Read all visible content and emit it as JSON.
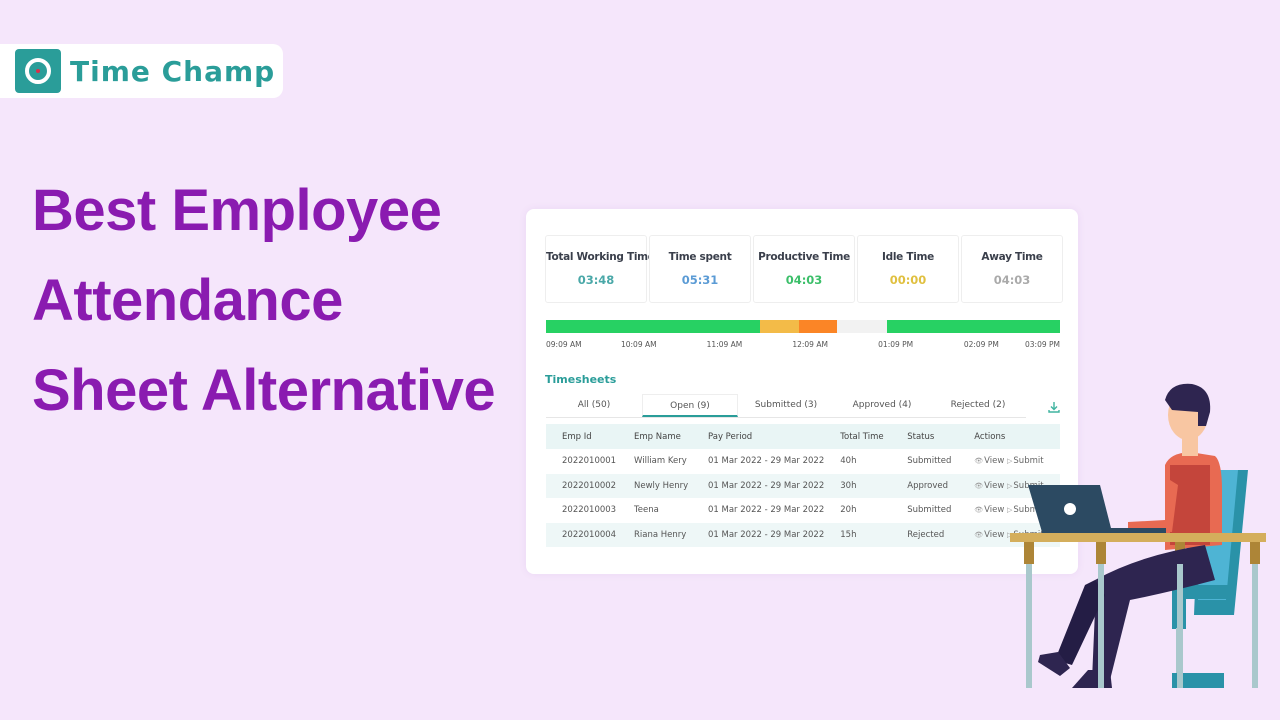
{
  "brand": {
    "name": "Time Champ",
    "icon": "clock-icon",
    "color": "#2a9d99"
  },
  "headline": {
    "lines": [
      "Best Employee",
      "Attendance",
      "Sheet Alternative"
    ],
    "color": "#8a1bb0"
  },
  "stats": [
    {
      "label": "Total Working Time",
      "value": "03:48",
      "color": "#4aa8a8"
    },
    {
      "label": "Time spent",
      "value": "05:31",
      "color": "#5b9bd5"
    },
    {
      "label": "Productive Time",
      "value": "04:03",
      "color": "#3cbf6a"
    },
    {
      "label": "Idle Time",
      "value": "00:00",
      "color": "#e0c040"
    },
    {
      "label": "Away Time",
      "value": "04:03",
      "color": "#aaaaaa"
    }
  ],
  "timeline": {
    "segments": [
      {
        "type": "productive",
        "fraction": 0.417,
        "color": "#27d163"
      },
      {
        "type": "idle",
        "fraction": 0.076,
        "color": "#f3bb48"
      },
      {
        "type": "away",
        "fraction": 0.074,
        "color": "#fb8526"
      },
      {
        "type": "offline",
        "fraction": 0.096,
        "color": "#f2f2f2"
      },
      {
        "type": "productive",
        "fraction": 0.337,
        "color": "#27d163"
      }
    ],
    "ticks": [
      "09:09 AM",
      "10:09 AM",
      "11:09 AM",
      "12:09 AM",
      "01:09 PM",
      "02:09 PM",
      "03:09 PM"
    ]
  },
  "timesheets": {
    "title": "Timesheets",
    "tabs": [
      {
        "label": "All (50)",
        "active": false
      },
      {
        "label": "Open (9)",
        "active": true
      },
      {
        "label": "Submitted (3)",
        "active": false
      },
      {
        "label": "Approved (4)",
        "active": false
      },
      {
        "label": "Rejected (2)",
        "active": false
      }
    ],
    "download_icon": "download-icon",
    "columns": [
      "Emp Id",
      "Emp Name",
      "Pay Period",
      "Total Time",
      "Status",
      "Actions"
    ],
    "rows": [
      {
        "emp_id": "2022010001",
        "name": "William Kery",
        "period": "01 Mar 2022 - 29 Mar 2022",
        "total": "40h",
        "status": "Submitted"
      },
      {
        "emp_id": "2022010002",
        "name": "Newly Henry",
        "period": "01 Mar 2022 - 29 Mar 2022",
        "total": "30h",
        "status": "Approved"
      },
      {
        "emp_id": "2022010003",
        "name": "Teena",
        "period": "01 Mar 2022 - 29 Mar 2022",
        "total": "20h",
        "status": "Submitted"
      },
      {
        "emp_id": "2022010004",
        "name": "Riana Henry",
        "period": "01 Mar 2022 - 29 Mar 2022",
        "total": "15h",
        "status": "Rejected"
      }
    ],
    "actions": {
      "view": "View",
      "submit": "Submit",
      "view_icon": "eye-icon",
      "submit_icon": "play-icon"
    }
  },
  "illustration": "person-at-desk-with-laptop"
}
